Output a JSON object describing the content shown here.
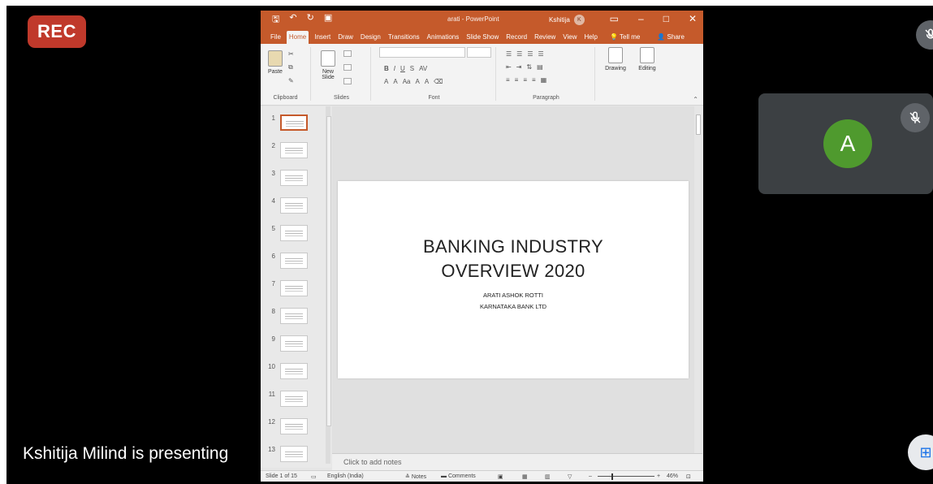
{
  "meeting": {
    "rec_label": "REC",
    "presenter_caption": "Kshitija Milind is presenting",
    "participant_initial": "A",
    "colors": {
      "rec": "#c0392b",
      "avatar": "#4f9a2e",
      "tile": "#3c4043"
    }
  },
  "ppt": {
    "window_title": "arati - PowerPoint",
    "user_name": "Kshitija",
    "user_initial": "K",
    "accent": "#c55a2b",
    "tabs": [
      "File",
      "Home",
      "Insert",
      "Draw",
      "Design",
      "Transitions",
      "Animations",
      "Slide Show",
      "Record",
      "Review",
      "View",
      "Help"
    ],
    "active_tab": "Home",
    "tell_me": "Tell me",
    "share": "Share",
    "ribbon": {
      "paste": "Paste",
      "clipboard": "Clipboard",
      "new_slide_1": "New",
      "new_slide_2": "Slide",
      "slides": "Slides",
      "font": "Font",
      "paragraph": "Paragraph",
      "drawing": "Drawing",
      "editing": "Editing"
    },
    "thumbnails": [
      "1",
      "2",
      "3",
      "4",
      "5",
      "6",
      "7",
      "8",
      "9",
      "10",
      "11",
      "12",
      "13"
    ],
    "selected_slide": "1",
    "slide": {
      "title_line1": "BANKING INDUSTRY",
      "title_line2": "OVERVIEW 2020",
      "subtitle_line1": "ARATI ASHOK ROTTI",
      "subtitle_line2": "KARNATAKA BANK LTD"
    },
    "notes_placeholder": "Click to add notes",
    "status": {
      "slide_count": "Slide 1 of 15",
      "language": "English (India)",
      "notes": "Notes",
      "comments": "Comments",
      "zoom": "46%"
    }
  }
}
